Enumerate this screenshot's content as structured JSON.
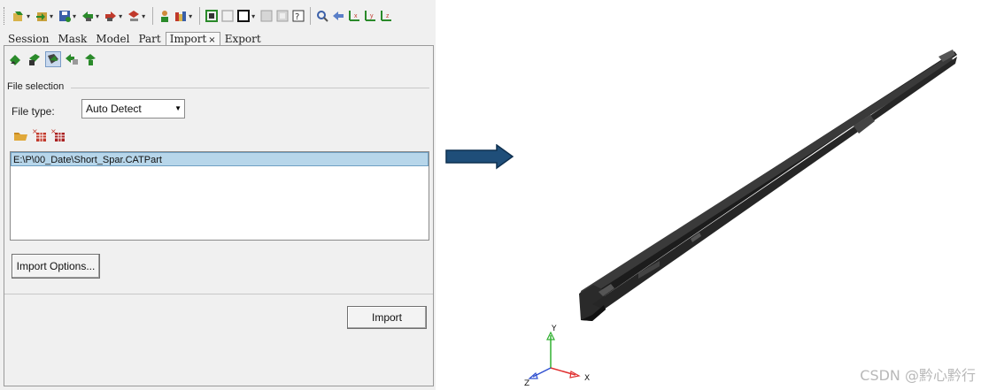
{
  "toolbar": {
    "icons": [
      "open-model-icon",
      "import-icon",
      "save-icon",
      "undo-icon",
      "redo-icon",
      "print-icon",
      "user-profile-icon",
      "display-icon",
      "select-box-icon",
      "square-icon",
      "shade-icon",
      "wireframe-icon",
      "fit-icon",
      "zoom-icon",
      "rotate-left-icon",
      "axis-x-icon",
      "axis-y-icon",
      "axis-z-icon"
    ],
    "accent": "#2a8a2a"
  },
  "tabs": [
    {
      "label": "Session"
    },
    {
      "label": "Mask"
    },
    {
      "label": "Model"
    },
    {
      "label": "Part"
    },
    {
      "label": "Import",
      "close": "×"
    },
    {
      "label": "Export"
    }
  ],
  "mode_icons": [
    "import-model-icon",
    "import-geometry-icon",
    "import-solver-deck-icon",
    "import-connectors-icon",
    "import-fe-overlay-icon"
  ],
  "file_selection": {
    "group_label": "File selection",
    "file_type_label": "File type:",
    "file_type_value": "Auto Detect",
    "file_icons": [
      "folder-open-icon",
      "remove-file-icon",
      "clear-list-icon"
    ],
    "files": [
      "E:\\P\\00_Date\\Short_Spar.CATPart"
    ]
  },
  "buttons": {
    "import_options": "Import Options...",
    "import": "Import"
  },
  "triad": {
    "y": "Y",
    "x": "X",
    "z": "Z"
  },
  "watermark": "CSDN @黔心黔行",
  "colors": {
    "arrow": "#1f4e79",
    "part": "#2b2b2b",
    "axis_x": "#e03030",
    "axis_y": "#30b030",
    "axis_z": "#3050d0"
  }
}
